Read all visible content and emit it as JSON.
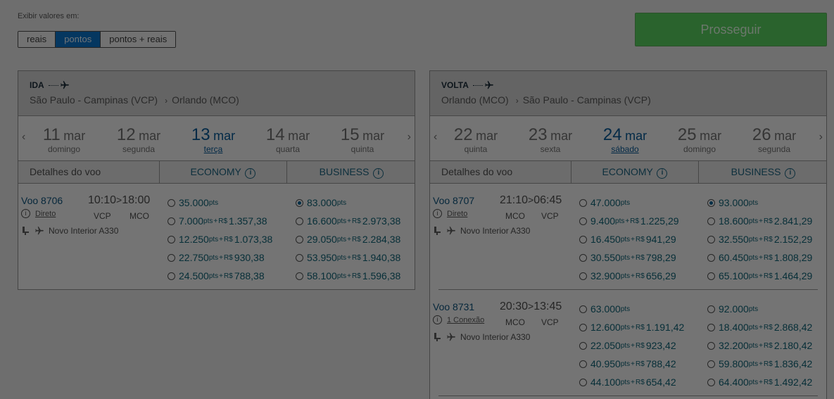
{
  "display": {
    "label": "Exibir valores em:",
    "options": [
      "reais",
      "pontos",
      "pontos + reais"
    ],
    "selected": "pontos"
  },
  "proceed_label": "Prosseguir",
  "colors": {
    "proceed": "#55c65a",
    "selected_toggle": "#0a6fc0",
    "accent_text": "#0f5e71"
  },
  "ida": {
    "direction": "IDA",
    "origin": "São Paulo - Campinas (VCP)",
    "destination": "Orlando (MCO)",
    "dates": [
      {
        "day": "11",
        "month": "mar",
        "weekday": "domingo"
      },
      {
        "day": "12",
        "month": "mar",
        "weekday": "segunda"
      },
      {
        "day": "13",
        "month": "mar",
        "weekday": "terça",
        "selected": true
      },
      {
        "day": "14",
        "month": "mar",
        "weekday": "quarta"
      },
      {
        "day": "15",
        "month": "mar",
        "weekday": "quinta"
      }
    ],
    "headers": {
      "details": "Detalhes do voo",
      "economy": "ECONOMY",
      "business": "BUSINESS"
    },
    "flights": [
      {
        "number": "Voo 8706",
        "dep": "10:10",
        "arr": "18:00",
        "sep": ">",
        "stops": "Direto",
        "from": "VCP",
        "to": "MCO",
        "aircraft": "Novo Interior A330",
        "economy": [
          {
            "pts": "35.000",
            "reais": ""
          },
          {
            "pts": "7.000",
            "reais": "1.357,38"
          },
          {
            "pts": "12.250",
            "reais": "1.073,38"
          },
          {
            "pts": "22.750",
            "reais": "930,38"
          },
          {
            "pts": "24.500",
            "reais": "788,38"
          }
        ],
        "business": [
          {
            "pts": "83.000",
            "reais": "",
            "selected": true
          },
          {
            "pts": "16.600",
            "reais": "2.973,38"
          },
          {
            "pts": "29.050",
            "reais": "2.284,38"
          },
          {
            "pts": "53.950",
            "reais": "1.940,38"
          },
          {
            "pts": "58.100",
            "reais": "1.596,38"
          }
        ]
      }
    ]
  },
  "volta": {
    "direction": "VOLTA",
    "origin": "Orlando (MCO)",
    "destination": "São Paulo - Campinas (VCP)",
    "dates": [
      {
        "day": "22",
        "month": "mar",
        "weekday": "quinta"
      },
      {
        "day": "23",
        "month": "mar",
        "weekday": "sexta"
      },
      {
        "day": "24",
        "month": "mar",
        "weekday": "sábado",
        "selected": true
      },
      {
        "day": "25",
        "month": "mar",
        "weekday": "domingo"
      },
      {
        "day": "26",
        "month": "mar",
        "weekday": "segunda"
      }
    ],
    "headers": {
      "details": "Detalhes do voo",
      "economy": "ECONOMY",
      "business": "BUSINESS"
    },
    "flights": [
      {
        "number": "Voo 8707",
        "dep": "21:10",
        "arr": "06:45",
        "sep": ">",
        "stops": "Direto",
        "from": "MCO",
        "to": "VCP",
        "aircraft": "Novo Interior A330",
        "economy": [
          {
            "pts": "47.000",
            "reais": ""
          },
          {
            "pts": "9.400",
            "reais": "1.225,29"
          },
          {
            "pts": "16.450",
            "reais": "941,29"
          },
          {
            "pts": "30.550",
            "reais": "798,29"
          },
          {
            "pts": "32.900",
            "reais": "656,29"
          }
        ],
        "business": [
          {
            "pts": "93.000",
            "reais": "",
            "selected": true
          },
          {
            "pts": "18.600",
            "reais": "2.841,29"
          },
          {
            "pts": "32.550",
            "reais": "2.152,29"
          },
          {
            "pts": "60.450",
            "reais": "1.808,29"
          },
          {
            "pts": "65.100",
            "reais": "1.464,29"
          }
        ]
      },
      {
        "number": "Voo 8731",
        "dep": "20:30",
        "arr": "13:45",
        "sep": ">",
        "stops": "1 Conexão",
        "from": "MCO",
        "to": "VCP",
        "aircraft": "Novo Interior A330",
        "economy": [
          {
            "pts": "63.000",
            "reais": ""
          },
          {
            "pts": "12.600",
            "reais": "1.191,42"
          },
          {
            "pts": "22.050",
            "reais": "923,42"
          },
          {
            "pts": "40.950",
            "reais": "788,42"
          },
          {
            "pts": "44.100",
            "reais": "654,42"
          }
        ],
        "business": [
          {
            "pts": "92.000",
            "reais": ""
          },
          {
            "pts": "18.400",
            "reais": "2.868,42"
          },
          {
            "pts": "32.200",
            "reais": "2.180,42"
          },
          {
            "pts": "59.800",
            "reais": "1.836,42"
          },
          {
            "pts": "64.400",
            "reais": "1.492,42"
          }
        ]
      }
    ]
  },
  "labels": {
    "pts": "pts",
    "plus": "+",
    "currency": "R$",
    "info": "i"
  }
}
